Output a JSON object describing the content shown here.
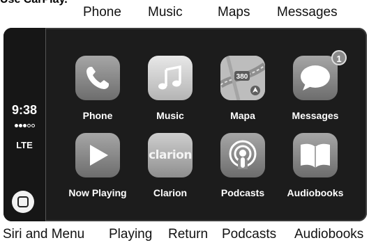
{
  "caption_clipped": "Use CarPlay.",
  "top_labels": [
    "Phone",
    "Music",
    "Maps",
    "Messages"
  ],
  "bottom_labels": [
    "Siri and Menu",
    "Playing",
    "Return",
    "Podcasts",
    "Audiobooks"
  ],
  "status": {
    "time": "9:38",
    "signal_dots_filled": 3,
    "signal_dots_total": 5,
    "network": "LTE"
  },
  "apps": [
    {
      "label": "Phone",
      "icon": "phone-handset-icon"
    },
    {
      "label": "Music",
      "icon": "music-note-icon"
    },
    {
      "label": "Mapa",
      "icon": "map-icon",
      "map_sign": "380"
    },
    {
      "label": "Messages",
      "icon": "speech-bubble-icon",
      "badge": "1"
    },
    {
      "label": "Now Playing",
      "icon": "play-icon"
    },
    {
      "label": "Clarion",
      "icon": "clarion-logo-icon",
      "brand_text": "clarion"
    },
    {
      "label": "Podcasts",
      "icon": "podcast-icon"
    },
    {
      "label": "Audiobooks",
      "icon": "open-book-icon"
    }
  ],
  "colors": {
    "screen_bg": "#1c1c1c",
    "sidebar_bg": "#161616",
    "text": "#ffffff"
  }
}
